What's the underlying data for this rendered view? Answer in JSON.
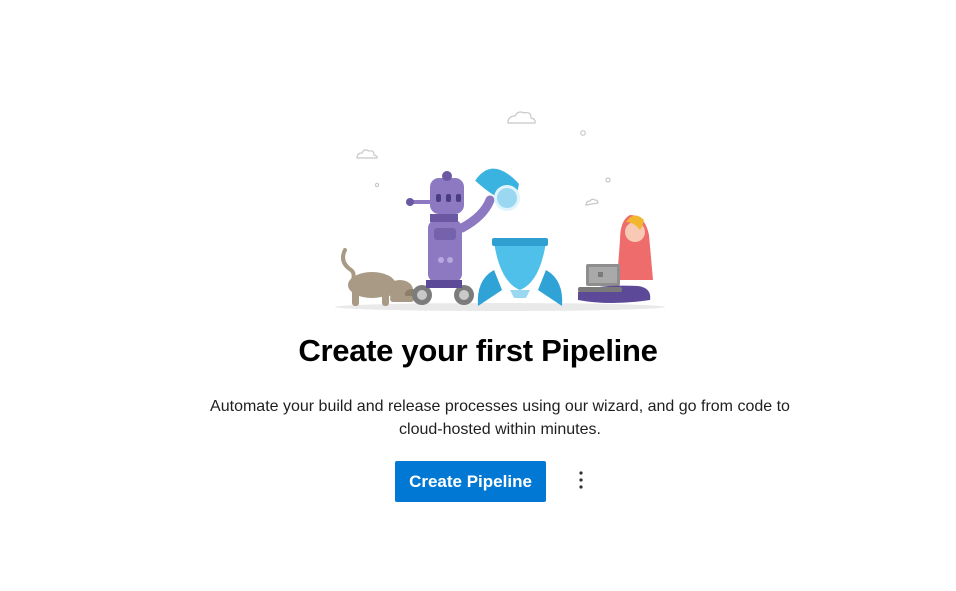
{
  "empty_state": {
    "title": "Create your first Pipeline",
    "description": "Automate your build and release processes using our wizard, and go from code to cloud-hosted within minutes.",
    "primary_action_label": "Create Pipeline",
    "more_actions_icon": "more-vertical-icon",
    "illustration": "robot-rocket-dog-developer-illustration"
  },
  "colors": {
    "primary_button": "#0078d4",
    "title_text": "#000000",
    "body_text": "#201f1e"
  }
}
